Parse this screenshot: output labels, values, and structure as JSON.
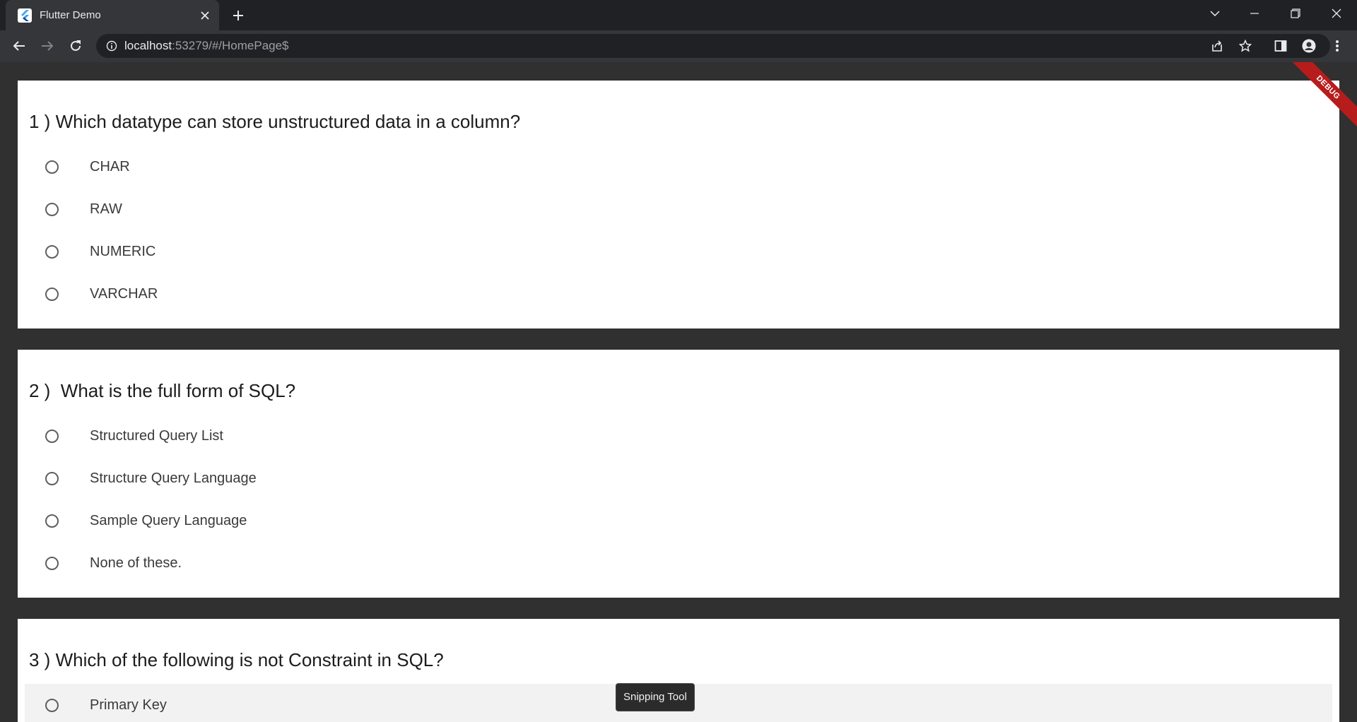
{
  "browser": {
    "tab_title": "Flutter Demo",
    "url_host": "localhost",
    "url_rest": ":53279/#/HomePage$"
  },
  "debug_banner": "DEBUG",
  "questions": [
    {
      "text": "1 ) Which datatype can store unstructured data in a column?",
      "options": [
        "CHAR",
        "RAW",
        "NUMERIC",
        "VARCHAR"
      ]
    },
    {
      "text": "2 )  What is the full form of SQL?",
      "options": [
        "Structured Query List",
        "Structure Query Language",
        "Sample Query Language",
        "None of these."
      ]
    },
    {
      "text": "3 ) Which of the following is not Constraint in SQL?",
      "options": [
        "Primary Key"
      ]
    }
  ],
  "tooltip": "Snipping Tool",
  "colors": {
    "page_bg": "#303030",
    "card_bg": "#ffffff",
    "debug_banner": "#b71c1c"
  }
}
